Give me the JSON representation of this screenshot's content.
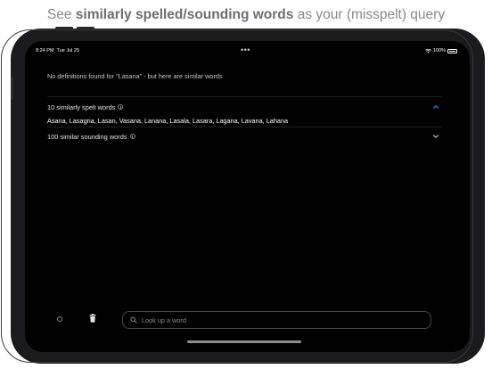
{
  "caption": {
    "prefix": "See ",
    "bold": "similarly spelled/sounding words",
    "suffix": " as your (misspelt) query"
  },
  "statusbar": {
    "time": "8:24 PM",
    "date": "Tue Jul 25",
    "dots": "•••",
    "battery_text": "100%"
  },
  "notice": "No definitions found for \"Lasana\" - but here are similar words",
  "spelt_section": {
    "title": "10 similarly spelt words",
    "expanded": true,
    "words": "Asana, Lasagna, Lasan, Vasana, Lanana, Lasala, Lasara, Lagana, Lavana, Lahana"
  },
  "sounding_section": {
    "title": "100 similar sounding words",
    "expanded": false
  },
  "search": {
    "placeholder": "Look up a word",
    "value": ""
  },
  "icons": {
    "info": "info-icon",
    "collapse": "chevron-up-icon",
    "expand": "chevron-down-icon",
    "history": "circle-icon",
    "delete": "trash-icon",
    "search": "search-icon"
  },
  "colors": {
    "accent": "#0a84ff",
    "screen_bg": "#000000"
  }
}
